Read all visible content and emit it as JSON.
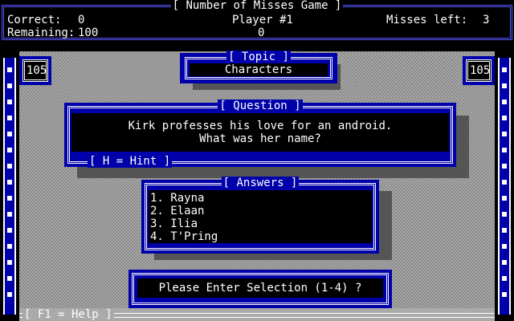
{
  "header": {
    "title": "[ Number of Misses Game ]",
    "correct_label": "Correct:",
    "correct_value": "0",
    "remaining_label": "Remaining:",
    "remaining_value": "100",
    "player_label": "Player #1",
    "player_score": "0",
    "misses_label": "Misses left:",
    "misses_value": "3"
  },
  "counters": {
    "left": "105",
    "right": "105"
  },
  "topic": {
    "title": "[ Topic ]",
    "value": "Characters"
  },
  "question": {
    "title": "[ Question ]",
    "line1": "Kirk professes his love for an android.",
    "line2": "What was her name?",
    "hint": "[ H = Hint ]"
  },
  "answers": {
    "title": "[ Answers ]",
    "items": [
      "1. Rayna",
      "2. Elaan",
      "3. Ilia",
      "4. T'Pring"
    ]
  },
  "prompt": "Please Enter Selection (1-4) ?",
  "help": "[ F1 = Help ]"
}
